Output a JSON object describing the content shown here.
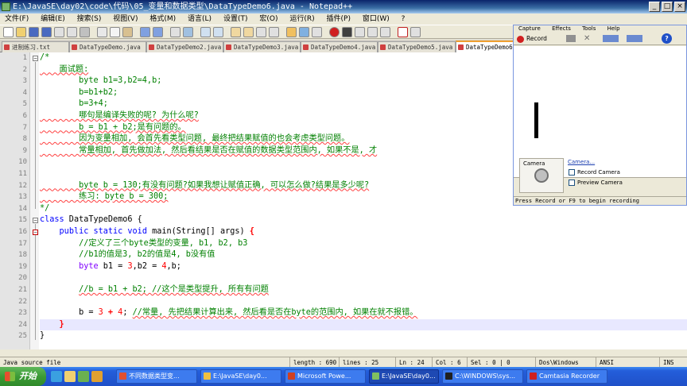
{
  "window": {
    "title": "E:\\JavaSE\\day02\\code\\代码\\05_变量和数据类型\\DataTypeDemo6.java - Notepad++"
  },
  "menu": [
    "文件(F)",
    "编辑(E)",
    "搜索(S)",
    "视图(V)",
    "格式(M)",
    "语言(L)",
    "设置(T)",
    "宏(O)",
    "运行(R)",
    "插件(P)",
    "窗口(W)",
    "?"
  ],
  "tabs": [
    {
      "label": "进制练习.txt",
      "active": false
    },
    {
      "label": "DataTypeDemo.java",
      "active": false
    },
    {
      "label": "DataTypeDemo2.java",
      "active": false
    },
    {
      "label": "DataTypeDemo3.java",
      "active": false
    },
    {
      "label": "DataTypeDemo4.java",
      "active": false
    },
    {
      "label": "DataTypeDemo5.java",
      "active": false
    },
    {
      "label": "DataTypeDemo6",
      "active": true
    }
  ],
  "editor": {
    "line_numbers": [
      "1",
      "2",
      "3",
      "4",
      "5",
      "6",
      "7",
      "8",
      "9",
      "10",
      "11",
      "12",
      "13",
      "14",
      "15",
      "16",
      "17",
      "18",
      "19",
      "20",
      "21",
      "22",
      "23",
      "24",
      "25"
    ],
    "lines": {
      "l1": "/*",
      "l2": "    面试题:",
      "l3": "        byte b1=3,b2=4,b;",
      "l4": "        b=b1+b2;",
      "l5": "        b=3+4;",
      "l6": "        哪句是编译失败的呢? 为什么呢?",
      "l7": "        b = b1 + b2;是有问题的。",
      "l8": "        因为变量相加, 会首先看类型问题, 最终把结果赋值的也会考虑类型问题。",
      "l9": "        常量相加, 首先做加法, 然后看结果是否在赋值的数据类型范围内, 如果不是, 才",
      "l12": "        byte b = 130;有没有问题?如果我想让赋值正确, 可以怎么做?结果是多少呢?",
      "l13": "        练习: byte b = 300;",
      "l14": "*/",
      "l15_kw": "class",
      "l15_rest": " DataTypeDemo6 {",
      "l16_a": "public static void",
      "l16_b": " main(String[] args) ",
      "l16_c": "{",
      "l17": "//定义了三个byte类型的变量, b1, b2, b3",
      "l18": "//b1的值是3, b2的值是4, b没有值",
      "l19_kw": "byte",
      "l19_a": " b1 = ",
      "l19_n1": "3",
      "l19_b": ",b2 = ",
      "l19_n2": "4",
      "l19_c": ",b;",
      "l21": "//b = b1 + b2; //这个是类型提升, 所有有问题",
      "l23_a": "b = ",
      "l23_n1": "3",
      "l23_op": " + ",
      "l23_n2": "4",
      "l23_b": "; ",
      "l23_cm": "//常量, 先把结果计算出来, 然后看是否在byte的范围内, 如果在就不报错。",
      "l24": "}",
      "l25": "}"
    }
  },
  "recorder": {
    "menu": [
      "Capture",
      "Effects",
      "Tools",
      "Help"
    ],
    "record_label": "Record",
    "camera_label": "Camera",
    "camera_link": "Camera...",
    "record_camera": "Record Camera",
    "preview_camera": "Preview Camera",
    "status": "Press Record or F9 to begin recording"
  },
  "statusbar": {
    "type": "Java source file",
    "length": "length : 690",
    "lines": "lines : 25",
    "ln": "Ln : 24",
    "col": "Col : 6",
    "sel": "Sel : 0 | 0",
    "eol": "Dos\\Windows",
    "encoding": "ANSI",
    "mode": "INS"
  },
  "taskbar": {
    "start": "开始",
    "tasks": [
      {
        "label": "不同数据类型变...",
        "color": "#e05030"
      },
      {
        "label": "E:\\JavaSE\\day0...",
        "color": "#f0c040"
      },
      {
        "label": "Microsoft Powe...",
        "color": "#d04020"
      },
      {
        "label": "E:\\JavaSE\\day0...",
        "color": "#80c060",
        "active": true
      },
      {
        "label": "C:\\WINDOWS\\sys...",
        "color": "#202020"
      },
      {
        "label": "Camtasia Recorder",
        "color": "#d02020"
      }
    ]
  }
}
